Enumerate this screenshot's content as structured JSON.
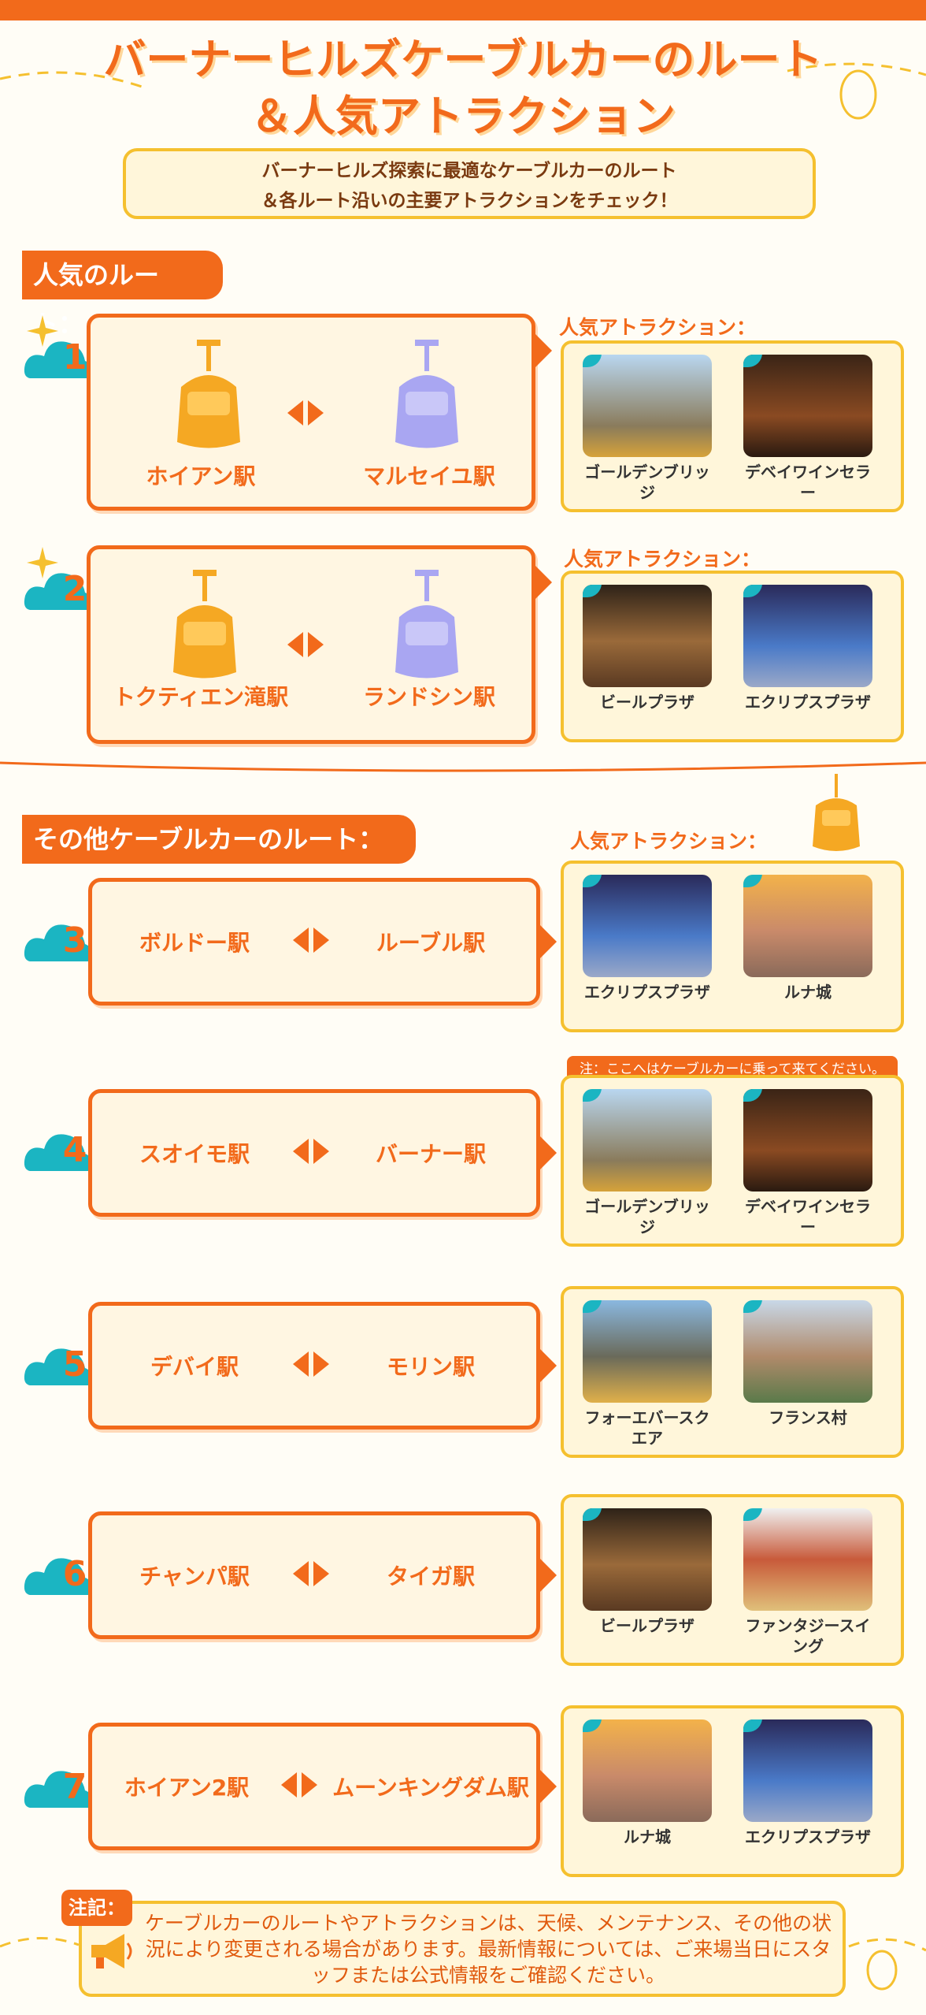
{
  "header": {
    "title_line1": "バーナーヒルズケーブルカーのルート",
    "title_line2": "＆人気アトラクション",
    "subtitle_line1": "バーナーヒルズ探索に最適なケーブルカーのルート",
    "subtitle_line2": "＆各ルート沿いの主要アトラクションをチェック！"
  },
  "sections": {
    "popular_label": "人気のルート：",
    "other_label": "その他ケーブルカーのルート：",
    "attractions_label": "人気アトラクション："
  },
  "routes": [
    {
      "number": "1",
      "from": "ホイアン駅",
      "to": "マルセイユ駅",
      "attractions": [
        "ゴールデンブリッジ",
        "デベイワインセラー"
      ]
    },
    {
      "number": "2",
      "from": "トクティエン滝駅",
      "to": "ランドシン駅",
      "attractions": [
        "ビールプラザ",
        "エクリプスプラザ"
      ]
    },
    {
      "number": "3",
      "from": "ボルドー駅",
      "to": "ルーブル駅",
      "attractions": [
        "エクリプスプラザ",
        "ルナ城"
      ]
    },
    {
      "number": "4",
      "from": "スオイモ駅",
      "to": "バーナー駅",
      "attractions": [
        "ゴールデンブリッジ",
        "デベイワインセラー"
      ]
    },
    {
      "number": "5",
      "from": "デバイ駅",
      "to": "モリン駅",
      "attractions": [
        "フォーエバースクエア",
        "フランス村"
      ]
    },
    {
      "number": "6",
      "from": "チャンパ駅",
      "to": "タイガ駅",
      "attractions": [
        "ビールプラザ",
        "ファンタジースイング"
      ]
    },
    {
      "number": "7",
      "from": "ホイアン2駅",
      "to": "ムーンキングダム駅",
      "attractions": [
        "ルナ城",
        "エクリプスプラザ"
      ]
    }
  ],
  "route4_note": "注：ここへはケーブルカーに乗って来てください。",
  "footer": {
    "tag": "注記：",
    "text": "ケーブルカーのルートやアトラクションは、天候、メンテナンス、その他の状況により変更される場合があります。最新情報については、ご来場当日にスタッフまたは公式情報をご確認ください。"
  },
  "colors": {
    "accent": "#f26a1b",
    "border_yellow": "#f5c02f",
    "cloud_teal": "#1bb5c2",
    "gondola_orange": "#f5a823",
    "gondola_purple": "#a9a6f2"
  }
}
